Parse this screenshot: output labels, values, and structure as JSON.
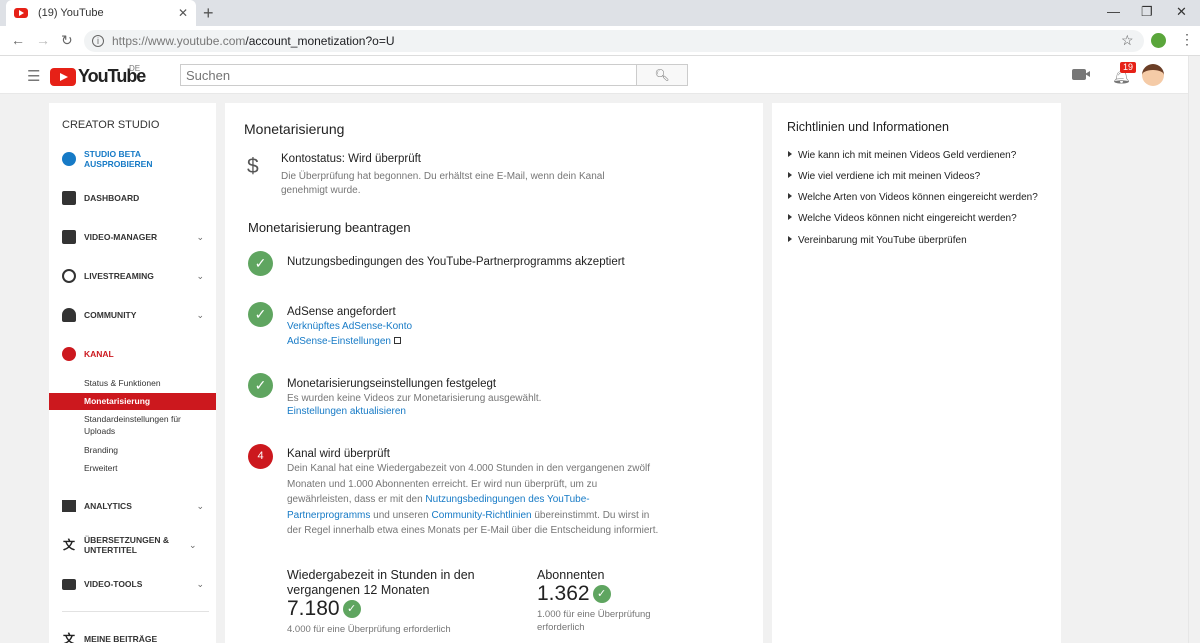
{
  "browser": {
    "tab_title": "(19) YouTube",
    "tab_close": "✕",
    "new_tab": "+",
    "url_host": "https://www.youtube.com",
    "url_path": "/account_monetization?o=U"
  },
  "header": {
    "logo_text": "YouTube",
    "country": "DE",
    "search_placeholder": "Suchen",
    "notification_count": "19"
  },
  "sidebar": {
    "title": "CREATOR STUDIO",
    "items": [
      {
        "label": "STUDIO BETA AUSPROBIEREN",
        "icon": "gear-icon"
      },
      {
        "label": "DASHBOARD",
        "icon": "dashboard-icon"
      },
      {
        "label": "VIDEO-MANAGER",
        "icon": "video-manager-icon"
      },
      {
        "label": "LIVESTREAMING",
        "icon": "livestream-icon"
      },
      {
        "label": "COMMUNITY",
        "icon": "community-icon"
      },
      {
        "label": "KANAL",
        "icon": "channel-icon"
      },
      {
        "label": "ANALYTICS",
        "icon": "analytics-icon"
      },
      {
        "label": "ÜBERSETZUNGEN & UNTERTITEL",
        "icon": "translate-icon"
      },
      {
        "label": "VIDEO-TOOLS",
        "icon": "video-tools-icon"
      },
      {
        "label": "MEINE BEITRÄGE",
        "icon": "contributions-icon"
      }
    ],
    "kanal_sub": [
      "Status & Funktionen",
      "Monetarisierung",
      "Standardeinstellungen für Uploads",
      "Branding",
      "Erweitert"
    ]
  },
  "main": {
    "title": "Monetarisierung",
    "account_status": "Kontostatus: Wird überprüft",
    "account_desc": "Die Überprüfung hat begonnen. Du erhältst eine E-Mail, wenn dein Kanal genehmigt wurde.",
    "apply_title": "Monetarisierung beantragen",
    "step1_title": "Nutzungsbedingungen des YouTube-Partnerprogramms akzeptiert",
    "step2_title": "AdSense angefordert",
    "step2_link1": "Verknüpftes AdSense-Konto",
    "step2_link2": "AdSense-Einstellungen",
    "step3_title": "Monetarisierungseinstellungen festgelegt",
    "step3_text": "Es wurden keine Videos zur Monetarisierung ausgewählt.",
    "step3_link": "Einstellungen aktualisieren",
    "step4_num": "4",
    "step4_title": "Kanal wird überprüft",
    "step4_text_a": "Dein Kanal hat eine Wiedergabezeit von 4.000 Stunden in den vergangenen zwölf Monaten und 1.000 Abonnenten erreicht. Er wird nun überprüft, um zu gewährleisten, dass er mit den ",
    "step4_link_a": "Nutzungsbedingungen des YouTube-Partnerprogramms",
    "step4_text_b": " und unseren ",
    "step4_link_b": "Community-Richtlinien",
    "step4_text_c": " übereinstimmt. Du wirst in der Regel innerhalb etwa eines Monats per E-Mail über die Entscheidung informiert.",
    "watch_label": "Wiedergabezeit in Stunden in den vergangenen 12 Monaten",
    "watch_value": "7.180",
    "watch_sub": "4.000 für eine Überprüfung erforderlich",
    "subs_label": "Abonnenten",
    "subs_value": "1.362",
    "subs_sub": "1.000 für eine Überprüfung erforderlich"
  },
  "right": {
    "title": "Richtlinien und Informationen",
    "links": [
      "Wie kann ich mit meinen Videos Geld verdienen?",
      "Wie viel verdiene ich mit meinen Videos?",
      "Welche Arten von Videos können eingereicht werden?",
      "Welche Videos können nicht eingereicht werden?",
      "Vereinbarung mit YouTube überprüfen"
    ]
  }
}
